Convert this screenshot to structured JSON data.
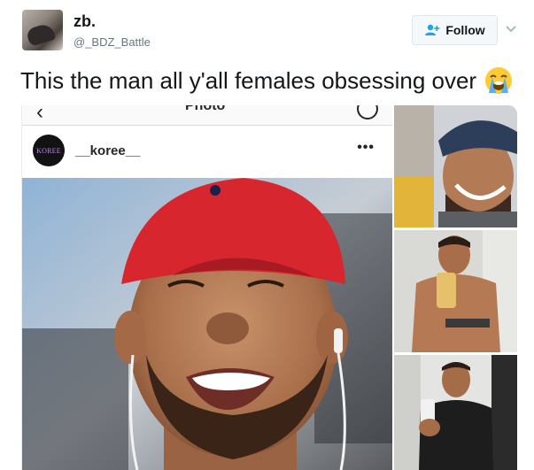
{
  "tweet": {
    "display_name": "zb.",
    "handle": "@_BDZ_Battle",
    "follow_label": "Follow",
    "text": "This the man all y'all females obsessing over",
    "emoji": "loudly-crying-face-emoji"
  },
  "embedded_post": {
    "title": "Photo",
    "username": "__koree__",
    "avatar_text": "KOREE",
    "more": "•••"
  },
  "icons": {
    "follow": "add-person-icon",
    "caret": "chevron-down-icon",
    "back": "chevron-left-icon",
    "refresh": "refresh-icon"
  },
  "colors": {
    "cap_red": "#d8262f",
    "text": "#14171a",
    "muted": "#657786",
    "follow_icon": "#1da1f2"
  }
}
